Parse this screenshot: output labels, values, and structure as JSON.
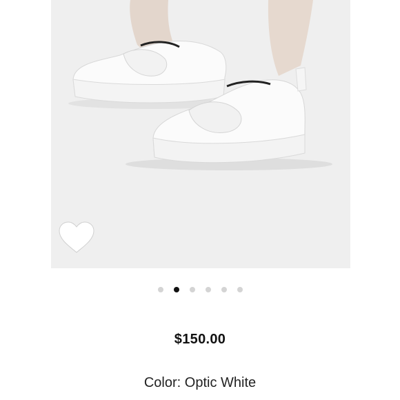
{
  "product": {
    "image_alt": "White platform slip-on sneakers with knotted front",
    "price": "$150.00",
    "color_label": "Color:",
    "color_value": "Optic White"
  },
  "carousel": {
    "total": 6,
    "active_index": 1
  },
  "icons": {
    "favorite": "heart-icon"
  },
  "colors": {
    "background": "#ffffff",
    "image_bg": "#efefef",
    "dot_inactive": "#d4d4d4",
    "dot_active": "#111111",
    "text": "#111111"
  }
}
